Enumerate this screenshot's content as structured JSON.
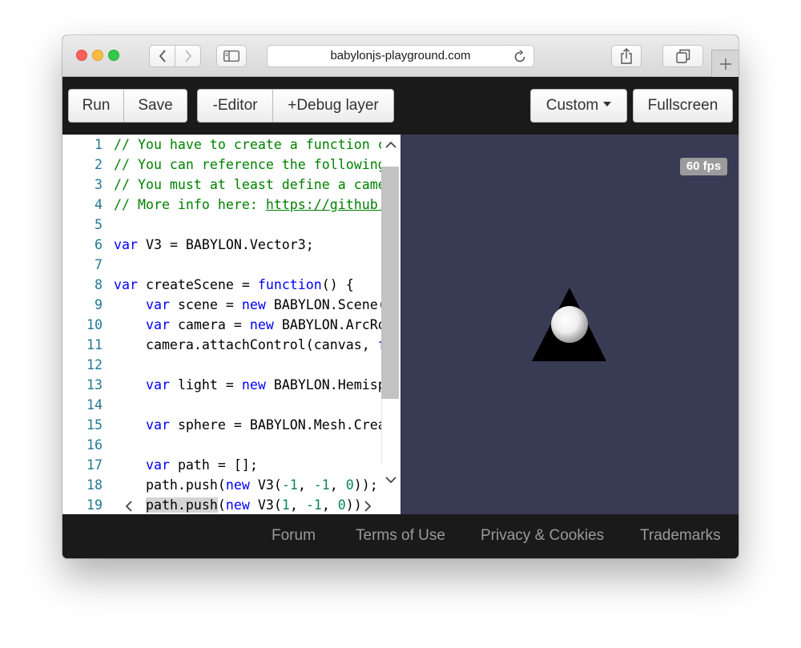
{
  "browser": {
    "url": "babylonjs-playground.com"
  },
  "toolbar": {
    "run_label": "Run",
    "save_label": "Save",
    "editor_label": "-Editor",
    "debug_label": "+Debug layer",
    "custom_label": "Custom",
    "fullscreen_label": "Fullscreen"
  },
  "editor": {
    "lines": [
      {
        "n": "1",
        "tokens": [
          {
            "t": "// You have to create a function cal",
            "c": "comment"
          }
        ]
      },
      {
        "n": "2",
        "tokens": [
          {
            "t": "// You can reference the following v",
            "c": "comment"
          }
        ]
      },
      {
        "n": "3",
        "tokens": [
          {
            "t": "// You must at least define a camera",
            "c": "comment"
          }
        ]
      },
      {
        "n": "4",
        "tokens": [
          {
            "t": "// More info here: ",
            "c": "comment"
          },
          {
            "t": "https://github.co",
            "c": "link"
          }
        ]
      },
      {
        "n": "5",
        "tokens": []
      },
      {
        "n": "6",
        "tokens": [
          {
            "t": "var",
            "c": "kw"
          },
          {
            "t": " V3 = BABYLON.Vector3;",
            "c": ""
          }
        ]
      },
      {
        "n": "7",
        "tokens": []
      },
      {
        "n": "8",
        "tokens": [
          {
            "t": "var",
            "c": "kw"
          },
          {
            "t": " createScene = ",
            "c": ""
          },
          {
            "t": "function",
            "c": "kw"
          },
          {
            "t": "() {",
            "c": ""
          }
        ]
      },
      {
        "n": "9",
        "tokens": [
          {
            "t": "    ",
            "c": ""
          },
          {
            "t": "var",
            "c": "kw"
          },
          {
            "t": " scene = ",
            "c": ""
          },
          {
            "t": "new",
            "c": "kw"
          },
          {
            "t": " BABYLON.Scene(en",
            "c": ""
          }
        ]
      },
      {
        "n": "10",
        "tokens": [
          {
            "t": "    ",
            "c": ""
          },
          {
            "t": "var",
            "c": "kw"
          },
          {
            "t": " camera = ",
            "c": ""
          },
          {
            "t": "new",
            "c": "kw"
          },
          {
            "t": " BABYLON.ArcRota",
            "c": ""
          }
        ]
      },
      {
        "n": "11",
        "tokens": [
          {
            "t": "    camera.attachControl(canvas, ",
            "c": ""
          },
          {
            "t": "fal",
            "c": "kw"
          }
        ]
      },
      {
        "n": "12",
        "tokens": []
      },
      {
        "n": "13",
        "tokens": [
          {
            "t": "    ",
            "c": ""
          },
          {
            "t": "var",
            "c": "kw"
          },
          {
            "t": " light = ",
            "c": ""
          },
          {
            "t": "new",
            "c": "kw"
          },
          {
            "t": " BABYLON.Hemisphe",
            "c": ""
          }
        ]
      },
      {
        "n": "14",
        "tokens": []
      },
      {
        "n": "15",
        "tokens": [
          {
            "t": "    ",
            "c": ""
          },
          {
            "t": "var",
            "c": "kw"
          },
          {
            "t": " sphere = BABYLON.Mesh.Create",
            "c": ""
          }
        ]
      },
      {
        "n": "16",
        "tokens": []
      },
      {
        "n": "17",
        "tokens": [
          {
            "t": "    ",
            "c": ""
          },
          {
            "t": "var",
            "c": "kw"
          },
          {
            "t": " path = [];",
            "c": ""
          }
        ]
      },
      {
        "n": "18",
        "tokens": [
          {
            "t": "    path.push(",
            "c": ""
          },
          {
            "t": "new",
            "c": "kw"
          },
          {
            "t": " V3(",
            "c": ""
          },
          {
            "t": "-1",
            "c": "num"
          },
          {
            "t": ", ",
            "c": ""
          },
          {
            "t": "-1",
            "c": "num"
          },
          {
            "t": ", ",
            "c": ""
          },
          {
            "t": "0",
            "c": "num"
          },
          {
            "t": "));",
            "c": ""
          }
        ]
      },
      {
        "n": "19",
        "tokens": [
          {
            "t": "    ",
            "c": ""
          },
          {
            "t": "path.push",
            "c": "sel"
          },
          {
            "t": "(",
            "c": ""
          },
          {
            "t": "new",
            "c": "kw"
          },
          {
            "t": " V3(",
            "c": ""
          },
          {
            "t": "1",
            "c": "num"
          },
          {
            "t": ", ",
            "c": ""
          },
          {
            "t": "-1",
            "c": "num"
          },
          {
            "t": ", ",
            "c": ""
          },
          {
            "t": "0",
            "c": "num"
          },
          {
            "t": "))",
            "c": ""
          }
        ]
      }
    ]
  },
  "scene": {
    "fps": "60 fps",
    "background_color": "#393b55",
    "triangle_color": "#000000",
    "sphere_color": "#ffffff"
  },
  "footer": {
    "forum": "Forum",
    "terms": "Terms of Use",
    "privacy": "Privacy & Cookies",
    "trademarks": "Trademarks"
  },
  "colors": {
    "keyword": "#0000ff",
    "comment": "#008000",
    "number": "#098658",
    "line_number": "#237893",
    "toolbar_bg": "#1a1a1a"
  },
  "icons": [
    "chevron-left-icon",
    "chevron-right-icon",
    "sidebar-icon",
    "reload-icon",
    "share-icon",
    "tabs-icon",
    "plus-icon",
    "caret-down-icon",
    "scroll-up-icon",
    "scroll-down-icon",
    "scroll-left-icon",
    "scroll-right-icon"
  ]
}
